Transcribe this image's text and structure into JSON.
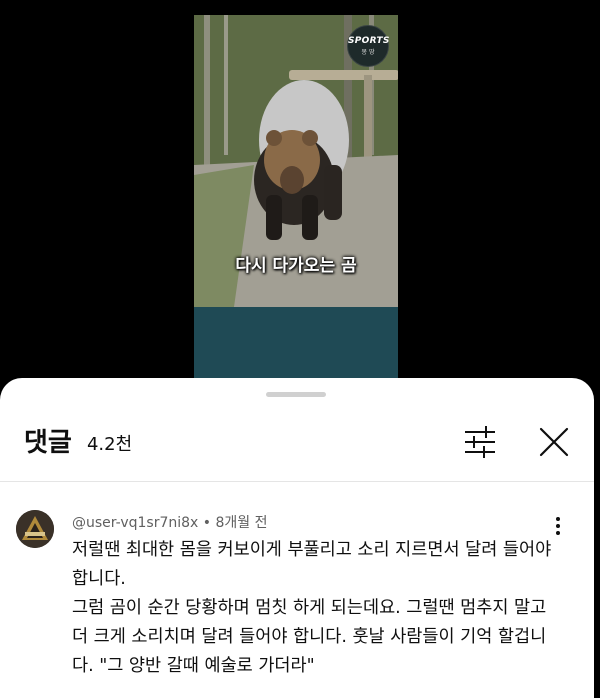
{
  "video": {
    "caption": "다시 다가오는 곰",
    "badge_line1": "SPORTS",
    "badge_line2": "몽 땅"
  },
  "comments_panel": {
    "title": "댓글",
    "count": "4.2천",
    "filter_icon": "sliders-icon",
    "close_icon": "close-icon"
  },
  "comment": {
    "author": "@user-vq1sr7ni8x",
    "separator": "•",
    "time": "8개월 전",
    "text": "저럴땐 최대한 몸을 커보이게 부풀리고 소리 지르면서 달려 들어야 합니다.\n그럼 곰이 순간 당황하며 멈칫 하게 되는데요. 그럴땐 멈추지 말고 더 크게 소리치며 달려 들어야 합니다. 훗날 사람들이 기억 할겁니다. \"그 양반 갈때 예술로 가더라\"",
    "more_icon": "more-vertical-icon"
  }
}
